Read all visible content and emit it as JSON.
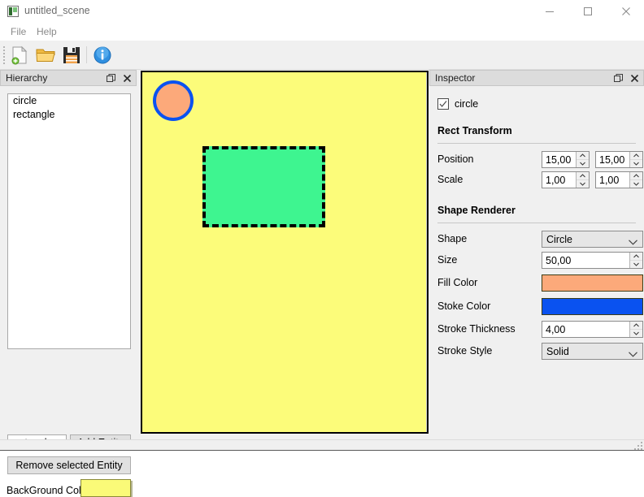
{
  "window": {
    "title": "untitled_scene",
    "app_icon": "scene-app-icon",
    "controls": {
      "minimize": "minimize-icon",
      "maximize": "maximize-icon",
      "close": "close-icon"
    }
  },
  "menubar": {
    "items": [
      {
        "label": "File"
      },
      {
        "label": "Help"
      }
    ]
  },
  "toolbar": {
    "buttons": [
      {
        "name": "new-file-button",
        "icon": "new-document-icon",
        "tooltip": "New"
      },
      {
        "name": "open-file-button",
        "icon": "open-folder-icon",
        "tooltip": "Open"
      },
      {
        "name": "save-file-button",
        "icon": "floppy-disk-save-icon",
        "tooltip": "Save"
      },
      {
        "name": "info-button",
        "icon": "info-circle-icon",
        "tooltip": "Info"
      }
    ]
  },
  "hierarchy": {
    "title": "Hierarchy",
    "float_icon": "restore-window-icon",
    "close_icon": "close-icon",
    "entities": [
      {
        "name": "circle"
      },
      {
        "name": "rectangle"
      }
    ],
    "entity_name_input": {
      "value": "rectangle",
      "placeholder": ""
    },
    "add_entity_label": "Add Entity",
    "remove_entity_label": "Remove selected Entity",
    "background_color_label": "BackGround Color",
    "background_color_value": "#FAFA78"
  },
  "scene": {
    "background_color": "#FCFC7A",
    "shapes": [
      {
        "name": "circle",
        "type": "circle",
        "fill": "#FCA97A",
        "stroke": "#0A52F0",
        "stroke_thickness": 4,
        "stroke_style": "Solid",
        "size": 50,
        "position_x": "15,00",
        "position_y": "15,00"
      },
      {
        "name": "rectangle",
        "type": "rectangle",
        "fill": "#3EF590",
        "stroke": "#000000",
        "stroke_thickness": 4,
        "stroke_style": "Dashed"
      }
    ]
  },
  "inspector": {
    "title": "Inspector",
    "float_icon": "restore-window-icon",
    "close_icon": "close-icon",
    "entity_enabled": true,
    "entity_name": "circle",
    "sections": [
      {
        "heading": "Rect Transform",
        "fields": [
          {
            "label": "Position",
            "x": "15,00",
            "y": "15,00"
          },
          {
            "label": "Scale",
            "x": "1,00",
            "y": "1,00"
          }
        ]
      },
      {
        "heading": "Shape Renderer",
        "shape_label": "Shape",
        "shape_value": "Circle",
        "size_label": "Size",
        "size_value": "50,00",
        "fill_color_label": "Fill Color",
        "fill_color_value": "#FCA97A",
        "stroke_color_label": "Stoke Color",
        "stroke_color_value": "#0A52F0",
        "stroke_thickness_label": "Stroke Thickness",
        "stroke_thickness_value": "4,00",
        "stroke_style_label": "Stroke Style",
        "stroke_style_value": "Solid"
      }
    ]
  }
}
